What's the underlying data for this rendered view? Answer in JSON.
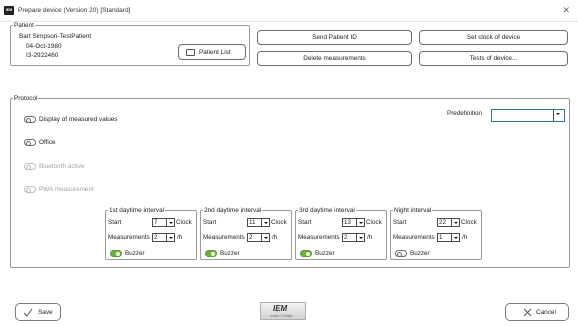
{
  "window": {
    "title": "Prepare device (Version 20) [Standard]",
    "app_icon_text": "IEM",
    "close_glyph": "✕"
  },
  "patient": {
    "legend": "Patient",
    "name": "Bart Simpson-TestPatient",
    "dob": "04-Oct-1980",
    "id": "I3-2922460",
    "list_button": "Patient List",
    "list_icon": "list-icon"
  },
  "actions": {
    "send_patient_id": "Send Patient ID",
    "set_clock": "Set clock of device",
    "delete_measurements": "Delete measurements",
    "tests_of_device": "Tests of device..."
  },
  "protocol": {
    "legend": "Protocol",
    "predefinition_label": "Predefinition",
    "predefinition_value": "",
    "toggles": [
      {
        "label": "Display of measured values",
        "on": false,
        "enabled": true
      },
      {
        "label": "Office",
        "on": false,
        "enabled": true
      },
      {
        "label": "Bluetooth active",
        "on": false,
        "enabled": false
      },
      {
        "label": "PWA measurement",
        "on": false,
        "enabled": false
      }
    ],
    "interval_labels": {
      "start": "Start",
      "clock": "Clock",
      "measurements": "Measurements",
      "per_hour": "/h",
      "buzzer": "Buzzer"
    },
    "intervals": [
      {
        "legend": "1st daytime interval",
        "start": "7",
        "measurements": "2",
        "buzzer_on": true
      },
      {
        "legend": "2nd daytime interval",
        "start": "11",
        "measurements": "2",
        "buzzer_on": true
      },
      {
        "legend": "3rd daytime interval",
        "start": "13",
        "measurements": "2",
        "buzzer_on": true
      },
      {
        "legend": "Night interval",
        "start": "22",
        "measurements": "1",
        "buzzer_on": false
      }
    ]
  },
  "footer": {
    "save": "Save",
    "cancel": "Cancel",
    "save_icon": "checkmark-icon",
    "cancel_icon": "close-icon",
    "logo_text": "IEM",
    "logo_subtext": "mobil-O-Graph"
  },
  "colors": {
    "toggle_on": "#6bb23a",
    "border": "#9a9a9a"
  }
}
